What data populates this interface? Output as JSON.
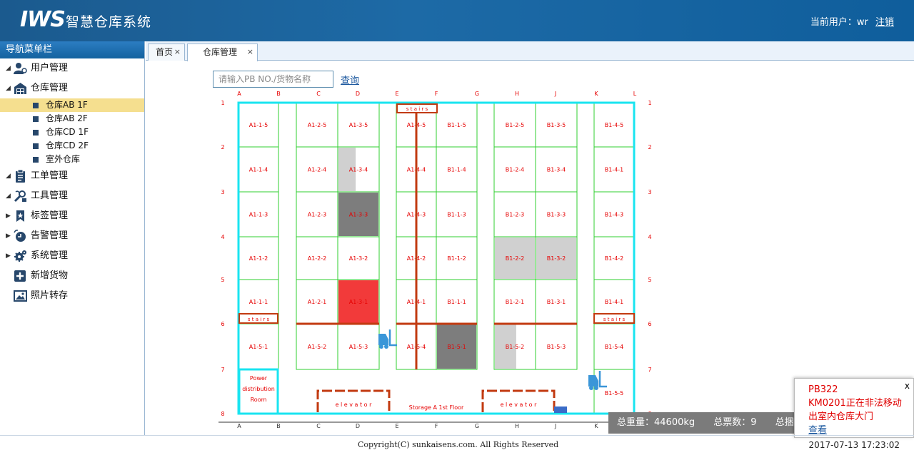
{
  "header": {
    "logo": "IWS",
    "title": "智慧仓库系统",
    "user_label": "当前用户：",
    "user_name": "wr",
    "logout": "注销"
  },
  "sidebar": {
    "title": "导航菜单栏",
    "items": [
      {
        "label": "用户管理",
        "icon": "user-icon",
        "arrow": "▲"
      },
      {
        "label": "仓库管理",
        "icon": "warehouse-icon",
        "arrow": "▲"
      },
      {
        "label": "工单管理",
        "icon": "clipboard-icon",
        "arrow": "▲"
      },
      {
        "label": "工具管理",
        "icon": "tools-icon",
        "arrow": "▲"
      },
      {
        "label": "标签管理",
        "icon": "tag-icon",
        "arrow": "▶"
      },
      {
        "label": "告警管理",
        "icon": "alarm-icon",
        "arrow": "▶"
      },
      {
        "label": "系统管理",
        "icon": "gear-icon",
        "arrow": "▶"
      },
      {
        "label": "新增货物",
        "icon": "add-icon",
        "arrow": ""
      },
      {
        "label": "照片转存",
        "icon": "photo-icon",
        "arrow": ""
      }
    ],
    "warehouse_sub": [
      "仓库AB 1F",
      "仓库AB 2F",
      "仓库CD 1F",
      "仓库CD 2F",
      "室外仓库"
    ]
  },
  "tabs": [
    {
      "label": "首页",
      "close": "×"
    },
    {
      "label": "仓库管理",
      "close": "×"
    }
  ],
  "search": {
    "placeholder": "请输入PB NO./货物名称",
    "button": "查询"
  },
  "map": {
    "col_labels": [
      "A",
      "B",
      "C",
      "D",
      "E",
      "F",
      "G",
      "H",
      "J",
      "K",
      "L"
    ],
    "row_labels": [
      "1",
      "2",
      "3",
      "4",
      "5",
      "6",
      "7",
      "8"
    ],
    "cells": [
      [
        "A1-1-5",
        "A1-2-5",
        "A1-3-5",
        "A1-4-5",
        "B1-1-5",
        "B1-2-5",
        "B1-3-5",
        "B1-4-5"
      ],
      [
        "A1-1-4",
        "A1-2-4",
        "A1-3-4",
        "A1-4-4",
        "B1-1-4",
        "B1-2-4",
        "B1-3-4",
        "B1-4-1"
      ],
      [
        "A1-1-3",
        "A1-2-3",
        "A1-3-3",
        "A1-4-3",
        "B1-1-3",
        "B1-2-3",
        "B1-3-3",
        "B1-4-3"
      ],
      [
        "A1-1-2",
        "A1-2-2",
        "A1-3-2",
        "A1-4-2",
        "B1-1-2",
        "B1-2-2",
        "B1-3-2",
        "B1-4-2"
      ],
      [
        "A1-1-1",
        "A1-2-1",
        "A1-3-1",
        "A1-4-1",
        "B1-1-1",
        "B1-2-1",
        "B1-3-1",
        "B1-4-1"
      ],
      [
        "A1-5-1",
        "A1-5-2",
        "A1-5-3",
        "A1-5-4",
        "B1-5-1",
        "B1-5-2",
        "B1-5-3",
        "B1-5-4"
      ]
    ],
    "extra_cell": "B1-5-5",
    "cell_states": {
      "A1-3-4": {
        "fill": "#d0d0d0",
        "level": 0.45
      },
      "A1-3-3": {
        "fill": "#7d7d7d",
        "level": 1
      },
      "A1-3-1": {
        "fill": "#f23a3a",
        "level": 1
      },
      "B1-2-2": {
        "fill": "#d0d0d0",
        "level": 1
      },
      "B1-3-2": {
        "fill": "#d0d0d0",
        "level": 1
      },
      "B1-5-1": {
        "fill": "#7d7d7d",
        "level": 1
      },
      "B1-5-2": {
        "fill": "#d0d0d0",
        "level": 0.55
      }
    },
    "stairs": "s t a i r s",
    "elevator": "e l e v a t o r",
    "power_room": [
      "Power",
      "distribution",
      "Room"
    ],
    "floor_label": "Storage A 1st Floor",
    "colors": {
      "wall": "#19e4f0",
      "grid": "#2fcf2f",
      "text": "#e60000",
      "conveyor": "#c23a10"
    }
  },
  "status": {
    "total_weight": "总重量：44600kg",
    "total_votes": "总票数：9",
    "total_pieces": "总捆数"
  },
  "notify": {
    "close": "x",
    "pb": "PB322",
    "line1": "KM0201正在非法移动",
    "line2": "出室内仓库大门",
    "link": "查看"
  },
  "footer": {
    "copyright": "Copyright(C) sunkaisens.com. All Rights Reserved",
    "datetime": "2017-07-13  17:23:02"
  }
}
